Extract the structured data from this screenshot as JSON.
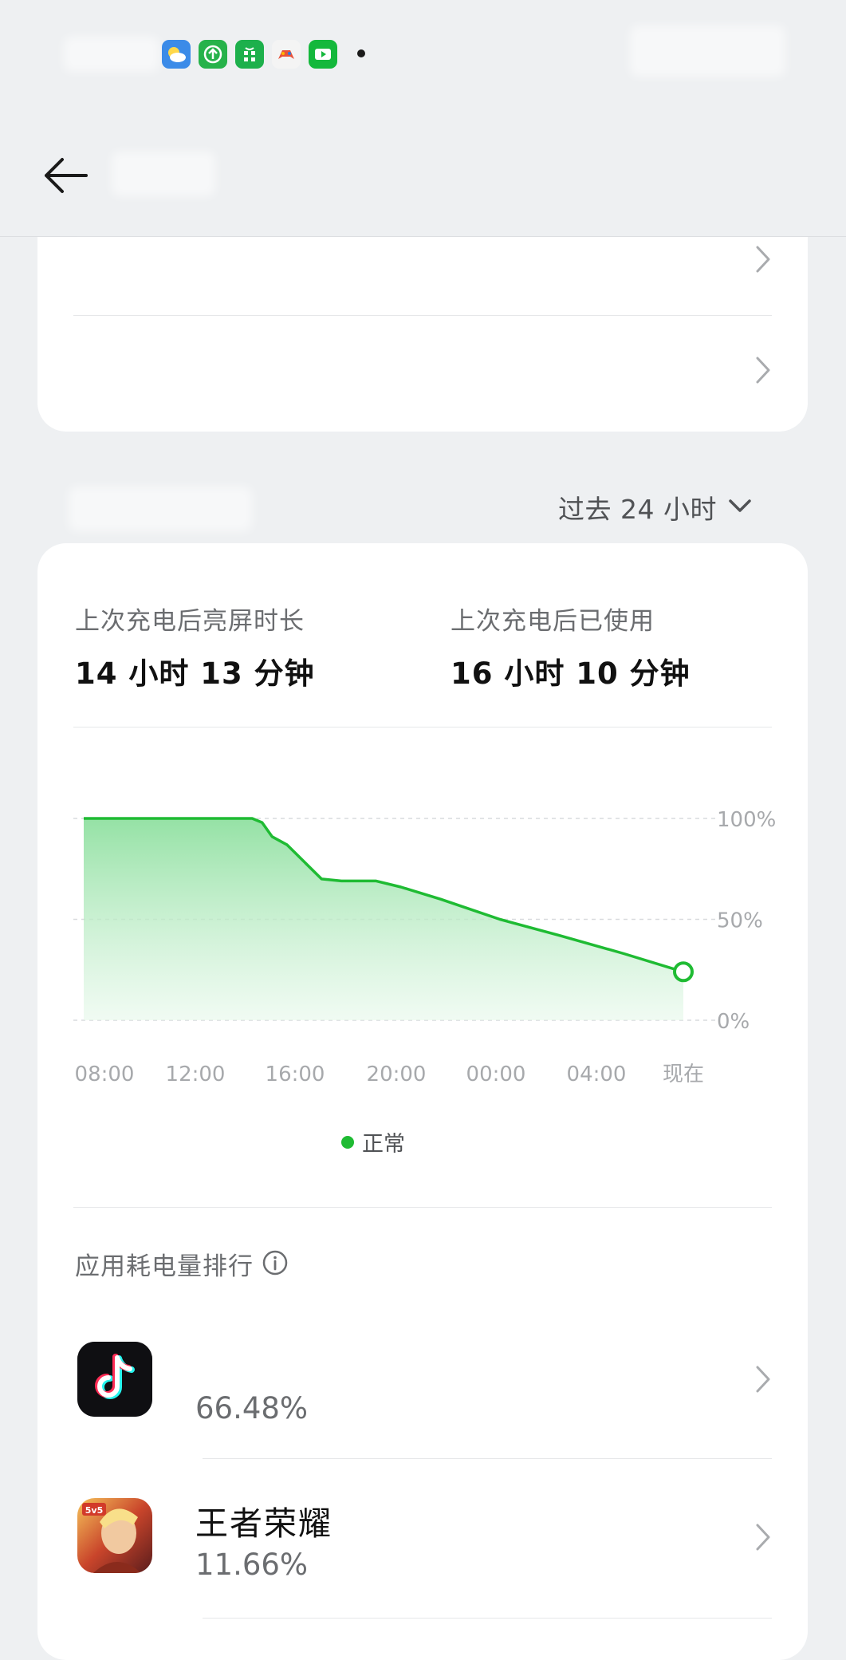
{
  "status_bar": {
    "notification_icons": [
      "weather-icon",
      "upload-icon",
      "app-store-icon",
      "game-icon",
      "battery-video-icon"
    ]
  },
  "header": {
    "back_icon": "arrow-left-icon"
  },
  "settings_card": {
    "rows": [
      {
        "label": "",
        "chevron": "chevron-right-icon"
      },
      {
        "label": "",
        "chevron": "chevron-right-icon"
      }
    ]
  },
  "period_selector": {
    "label": "过去 24 小时",
    "icon": "chevron-down-icon"
  },
  "usage": {
    "screen_on_label": "上次充电后亮屏时长",
    "screen_on_value": "14 小时 13 分钟",
    "used_label": "上次充电后已使用",
    "used_value": "16 小时 10 分钟"
  },
  "chart_data": {
    "type": "area",
    "x_tick_labels": [
      "08:00",
      "12:00",
      "16:00",
      "20:00",
      "00:00",
      "04:00",
      "现在"
    ],
    "y_tick_labels": [
      "100%",
      "50%",
      "0%"
    ],
    "ylim": [
      0,
      100
    ],
    "series": [
      {
        "name": "正常",
        "color": "#1fbb33",
        "points": [
          {
            "x": 0.0,
            "y": 100
          },
          {
            "x": 6.8,
            "y": 100
          },
          {
            "x": 7.2,
            "y": 98
          },
          {
            "x": 7.6,
            "y": 91
          },
          {
            "x": 8.2,
            "y": 87
          },
          {
            "x": 9.6,
            "y": 70
          },
          {
            "x": 10.4,
            "y": 69
          },
          {
            "x": 11.8,
            "y": 69
          },
          {
            "x": 12.8,
            "y": 66
          },
          {
            "x": 14.4,
            "y": 60
          },
          {
            "x": 16.8,
            "y": 50
          },
          {
            "x": 19.2,
            "y": 42
          },
          {
            "x": 21.8,
            "y": 33
          },
          {
            "x": 24.2,
            "y": 24
          }
        ]
      }
    ],
    "grid": true,
    "legend": "bottom"
  },
  "legend": {
    "label": "正常"
  },
  "ranking": {
    "title": "应用耗电量排行",
    "info_icon": "info-icon",
    "apps": [
      {
        "name": "",
        "percent": "66.48%",
        "icon": "tiktok-icon"
      },
      {
        "name": "王者荣耀",
        "percent": "11.66%",
        "icon": "honor-of-kings-icon"
      }
    ]
  }
}
